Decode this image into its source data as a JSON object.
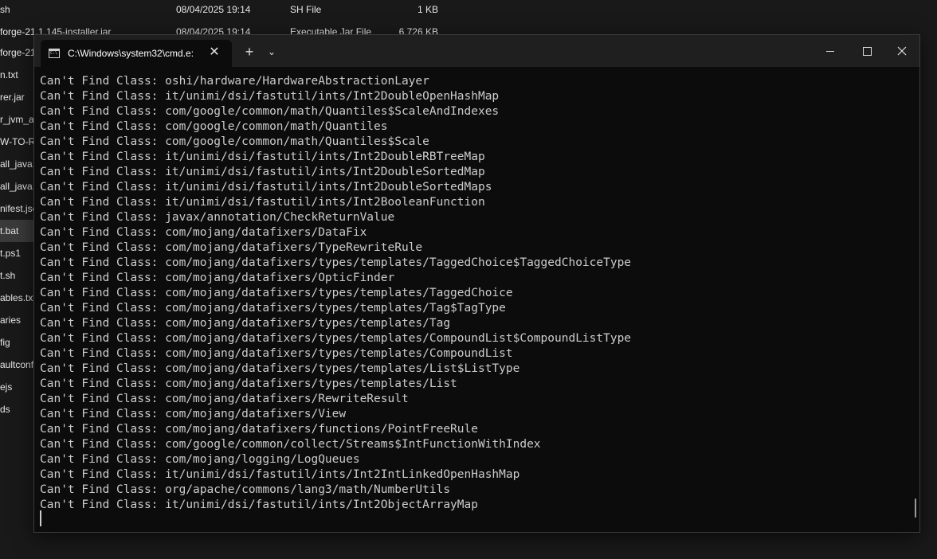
{
  "explorer": {
    "top_rows": [
      {
        "name": "sh",
        "date": "08/04/2025 19:14",
        "type": "SH File",
        "size": "1 KB"
      },
      {
        "name": "forge-21.1.145-installer.jar",
        "date": "08/04/2025 19:14",
        "type": "Executable Jar File",
        "size": "6,726 KB"
      }
    ],
    "side_items": [
      "forge-21",
      "n.txt",
      "rer.jar",
      "r_jvm_ar",
      "W-TO-R",
      "all_java.",
      "all_java.",
      "nifest.jsc",
      "t.bat",
      "t.ps1",
      "t.sh",
      "ables.txt",
      "aries",
      "fig",
      "aultconf",
      "ejs",
      "ds"
    ]
  },
  "terminal": {
    "tab_title": "C:\\Windows\\system32\\cmd.e:",
    "tab_close": "✕",
    "new_tab": "+",
    "dropdown": "⌄",
    "lines": [
      "Can't Find Class: oshi/hardware/HardwareAbstractionLayer",
      "Can't Find Class: it/unimi/dsi/fastutil/ints/Int2DoubleOpenHashMap",
      "Can't Find Class: com/google/common/math/Quantiles$ScaleAndIndexes",
      "Can't Find Class: com/google/common/math/Quantiles",
      "Can't Find Class: com/google/common/math/Quantiles$Scale",
      "Can't Find Class: it/unimi/dsi/fastutil/ints/Int2DoubleRBTreeMap",
      "Can't Find Class: it/unimi/dsi/fastutil/ints/Int2DoubleSortedMap",
      "Can't Find Class: it/unimi/dsi/fastutil/ints/Int2DoubleSortedMaps",
      "Can't Find Class: it/unimi/dsi/fastutil/ints/Int2BooleanFunction",
      "Can't Find Class: javax/annotation/CheckReturnValue",
      "Can't Find Class: com/mojang/datafixers/DataFix",
      "Can't Find Class: com/mojang/datafixers/TypeRewriteRule",
      "Can't Find Class: com/mojang/datafixers/types/templates/TaggedChoice$TaggedChoiceType",
      "Can't Find Class: com/mojang/datafixers/OpticFinder",
      "Can't Find Class: com/mojang/datafixers/types/templates/TaggedChoice",
      "Can't Find Class: com/mojang/datafixers/types/templates/Tag$TagType",
      "Can't Find Class: com/mojang/datafixers/types/templates/Tag",
      "Can't Find Class: com/mojang/datafixers/types/templates/CompoundList$CompoundListType",
      "Can't Find Class: com/mojang/datafixers/types/templates/CompoundList",
      "Can't Find Class: com/mojang/datafixers/types/templates/List$ListType",
      "Can't Find Class: com/mojang/datafixers/types/templates/List",
      "Can't Find Class: com/mojang/datafixers/RewriteResult",
      "Can't Find Class: com/mojang/datafixers/View",
      "Can't Find Class: com/mojang/datafixers/functions/PointFreeRule",
      "Can't Find Class: com/google/common/collect/Streams$IntFunctionWithIndex",
      "Can't Find Class: com/mojang/logging/LogQueues",
      "Can't Find Class: it/unimi/dsi/fastutil/ints/Int2IntLinkedOpenHashMap",
      "Can't Find Class: org/apache/commons/lang3/math/NumberUtils",
      "Can't Find Class: it/unimi/dsi/fastutil/ints/Int2ObjectArrayMap"
    ]
  },
  "colors": {
    "console_bg": "#0c0c0c",
    "console_text": "#cccccc",
    "titlebar_bg": "#1f1f1f"
  }
}
